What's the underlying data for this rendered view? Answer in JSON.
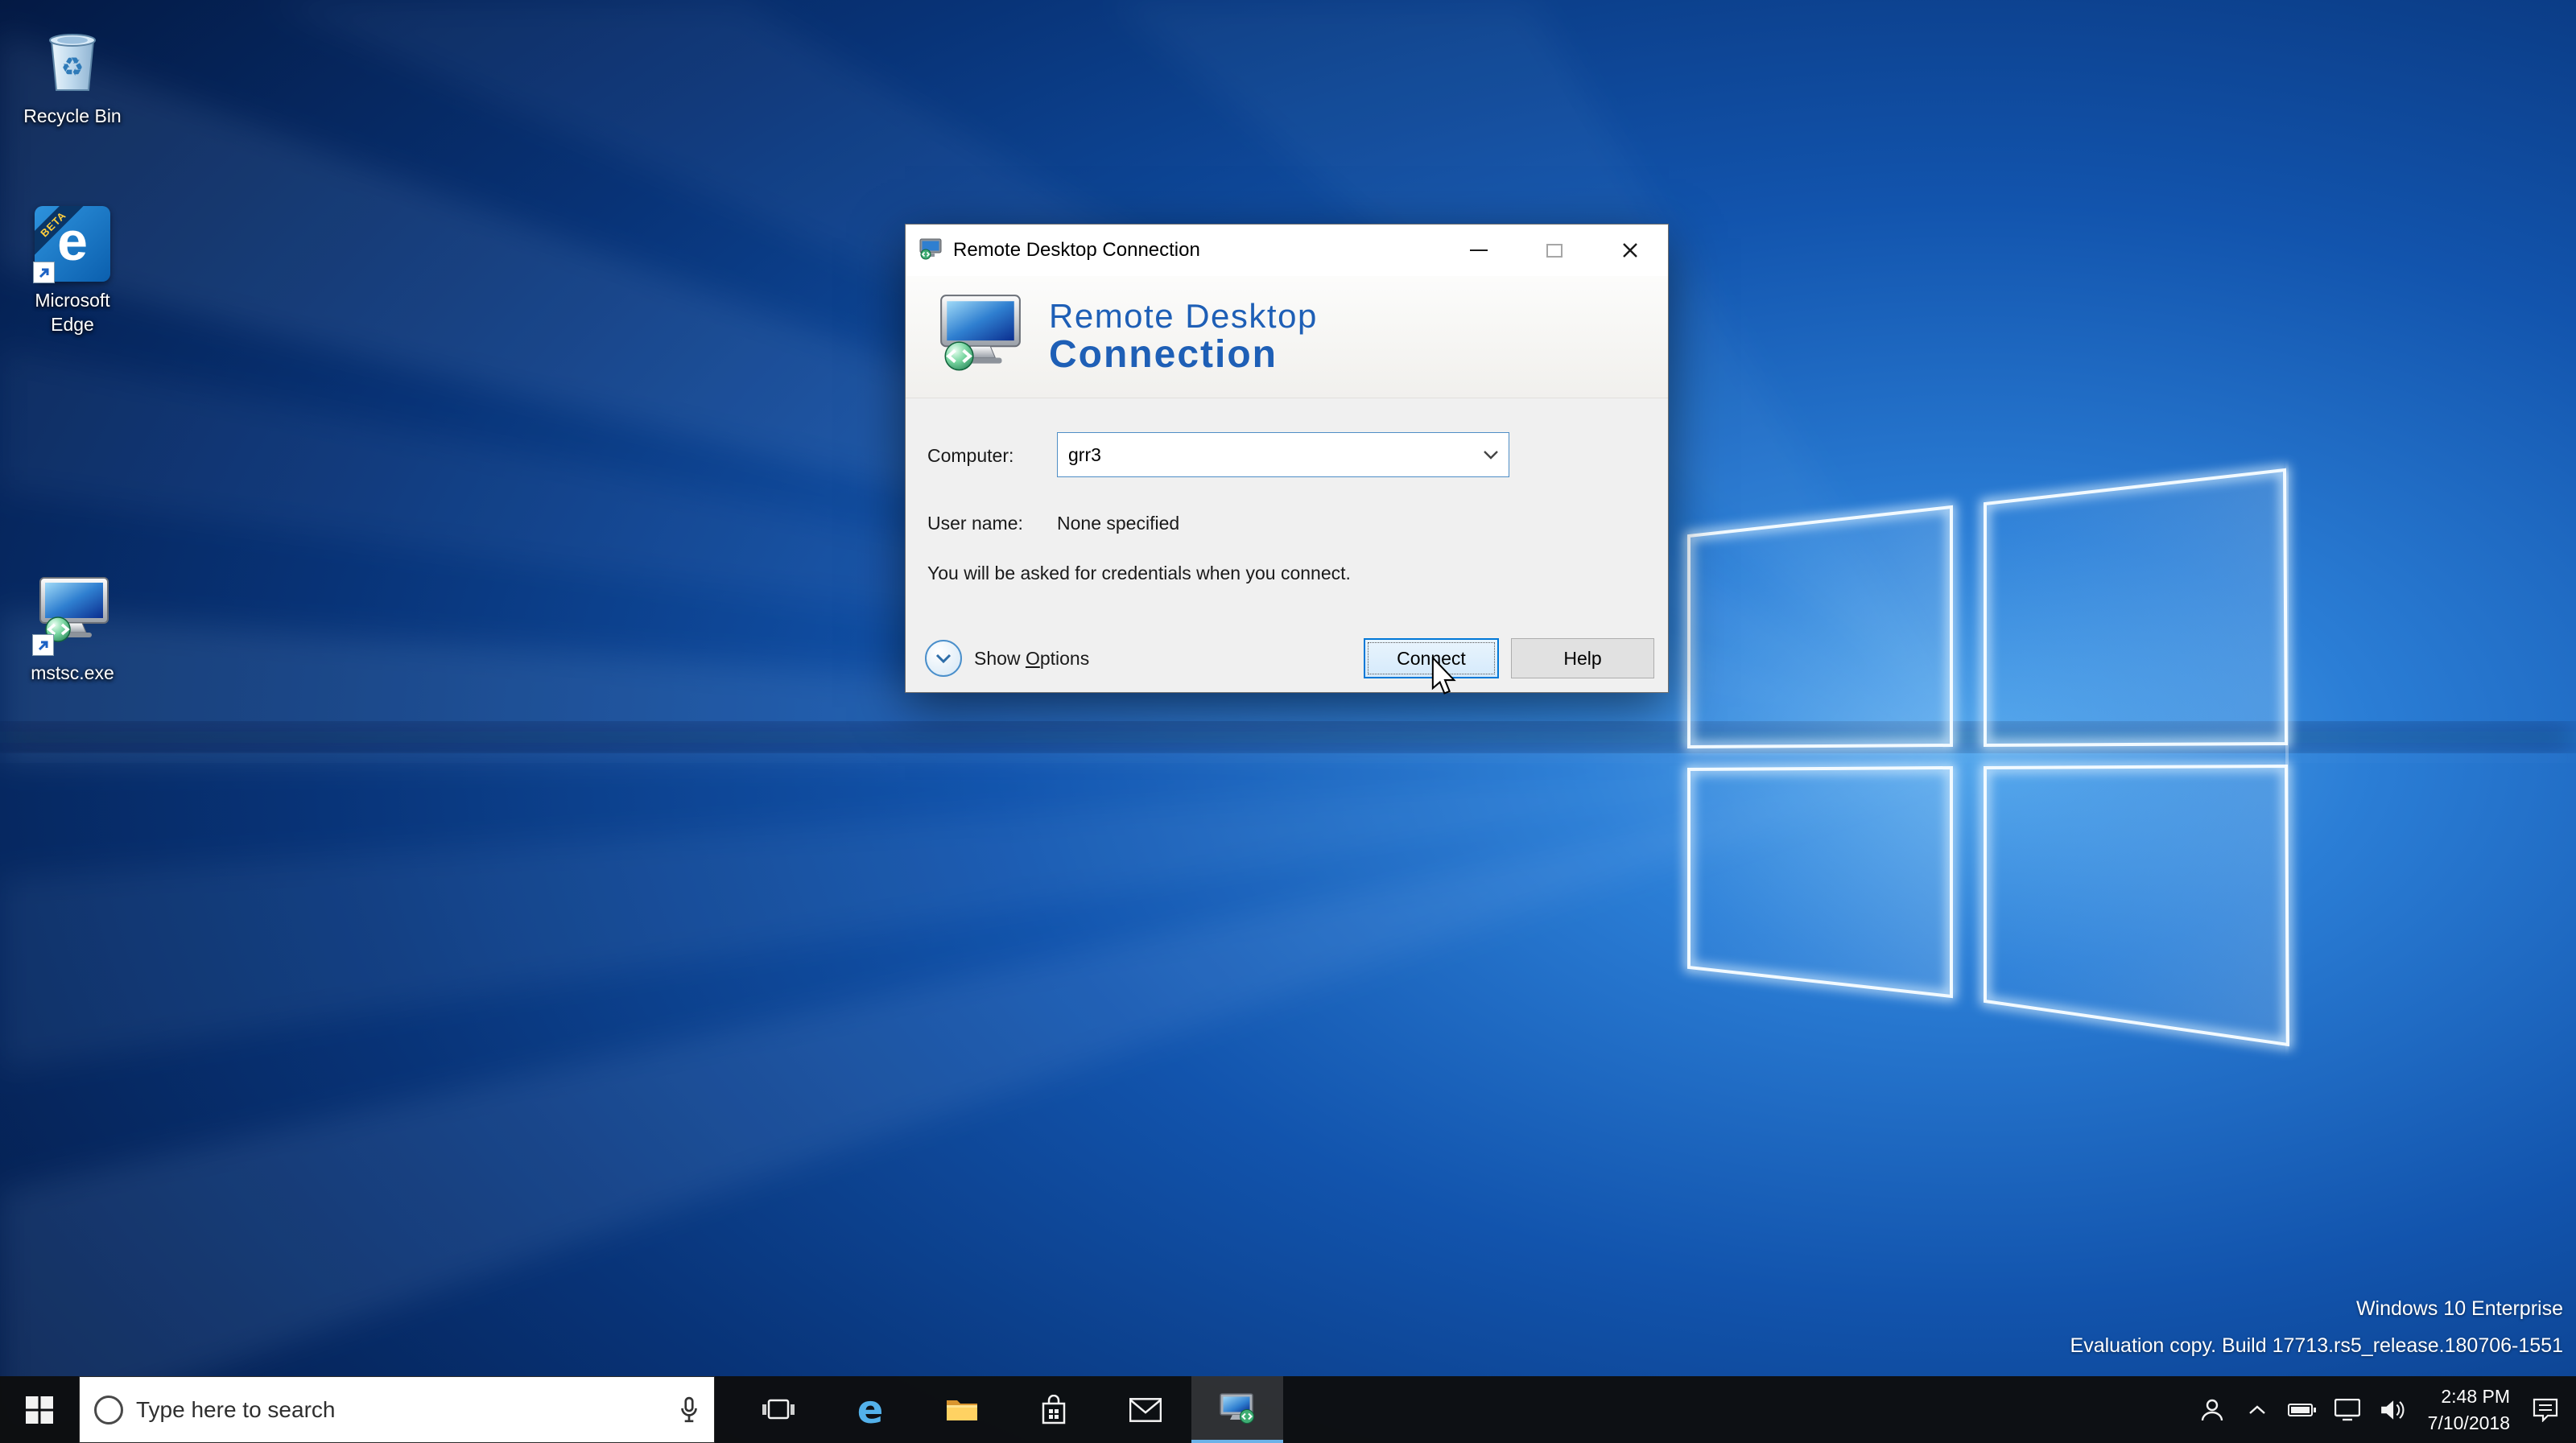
{
  "desktop": {
    "icons": [
      {
        "label": "Recycle Bin"
      },
      {
        "line1": "Microsoft",
        "line2": "Edge",
        "badge": "BETA"
      },
      {
        "label": "mstsc.exe"
      }
    ],
    "watermark": {
      "line1": "Windows 10 Enterprise",
      "line2": "Evaluation copy. Build 17713.rs5_release.180706-1551"
    }
  },
  "dialog": {
    "title": "Remote Desktop Connection",
    "brand": {
      "line1": "Remote Desktop",
      "line2": "Connection"
    },
    "computer": {
      "label": "Computer:",
      "value": "grr3"
    },
    "username": {
      "label": "User name:",
      "value": "None specified"
    },
    "note": "You will be asked for credentials when you connect.",
    "show_options": {
      "pre": "Show ",
      "key": "O",
      "post": "ptions"
    },
    "connect_label": "Connect",
    "help_label": "Help"
  },
  "taskbar": {
    "search_placeholder": "Type here to search",
    "clock": {
      "time": "2:48 PM",
      "date": "7/10/2018"
    }
  },
  "icons": {
    "edge_glyph": "e",
    "recycle_glyph": "♻"
  },
  "colors": {
    "accent": "#0078d7",
    "brand_blue": "#1e5fb6",
    "taskbar_bg": "#0d0e10"
  }
}
